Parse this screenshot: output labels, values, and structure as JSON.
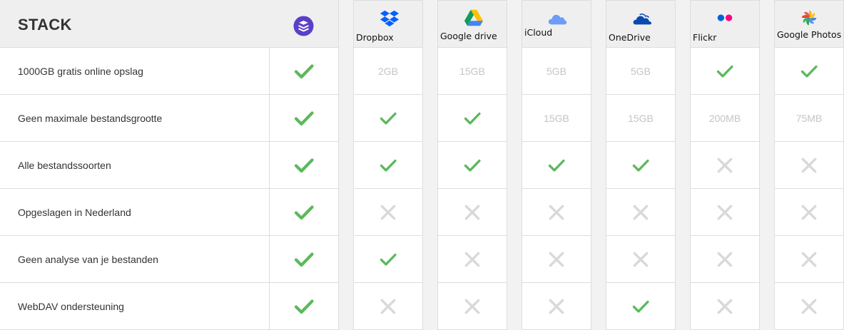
{
  "header": {
    "title": "STACK",
    "logo_icon": "stack-logo-icon",
    "accent": "#5b3fc8"
  },
  "colors": {
    "check": "#5cb85c",
    "cross": "#d9d9d9",
    "muted_text": "#c4c4c4"
  },
  "features": [
    {
      "label": "1000GB gratis online opslag",
      "stack": "check"
    },
    {
      "label": "Geen maximale bestandsgrootte",
      "stack": "check"
    },
    {
      "label": "Alle bestandssoorten",
      "stack": "check"
    },
    {
      "label": "Opgeslagen in Nederland",
      "stack": "check"
    },
    {
      "label": "Geen analyse van je bestanden",
      "stack": "check"
    },
    {
      "label": "WebDAV ondersteuning",
      "stack": "check"
    }
  ],
  "providers": [
    {
      "name": "Dropbox",
      "icon": "dropbox-icon",
      "values": [
        {
          "kind": "text",
          "text": "2GB"
        },
        {
          "kind": "check"
        },
        {
          "kind": "check"
        },
        {
          "kind": "cross"
        },
        {
          "kind": "check"
        },
        {
          "kind": "cross"
        }
      ]
    },
    {
      "name": "Google drive",
      "icon": "google-drive-icon",
      "values": [
        {
          "kind": "text",
          "text": "15GB"
        },
        {
          "kind": "check"
        },
        {
          "kind": "check"
        },
        {
          "kind": "cross"
        },
        {
          "kind": "cross"
        },
        {
          "kind": "cross"
        }
      ]
    },
    {
      "name": "iCloud",
      "icon": "icloud-icon",
      "values": [
        {
          "kind": "text",
          "text": "5GB"
        },
        {
          "kind": "text",
          "text": "15GB"
        },
        {
          "kind": "check"
        },
        {
          "kind": "cross"
        },
        {
          "kind": "cross"
        },
        {
          "kind": "cross"
        }
      ]
    },
    {
      "name": "OneDrive",
      "icon": "onedrive-icon",
      "values": [
        {
          "kind": "text",
          "text": "5GB"
        },
        {
          "kind": "text",
          "text": "15GB"
        },
        {
          "kind": "check"
        },
        {
          "kind": "cross"
        },
        {
          "kind": "cross"
        },
        {
          "kind": "check"
        }
      ]
    },
    {
      "name": "Flickr",
      "icon": "flickr-icon",
      "values": [
        {
          "kind": "check"
        },
        {
          "kind": "text",
          "text": "200MB"
        },
        {
          "kind": "cross"
        },
        {
          "kind": "cross"
        },
        {
          "kind": "cross"
        },
        {
          "kind": "cross"
        }
      ]
    },
    {
      "name": "Google Photos",
      "icon": "google-photos-icon",
      "values": [
        {
          "kind": "check"
        },
        {
          "kind": "text",
          "text": "75MB"
        },
        {
          "kind": "cross"
        },
        {
          "kind": "cross"
        },
        {
          "kind": "cross"
        },
        {
          "kind": "cross"
        }
      ]
    }
  ]
}
